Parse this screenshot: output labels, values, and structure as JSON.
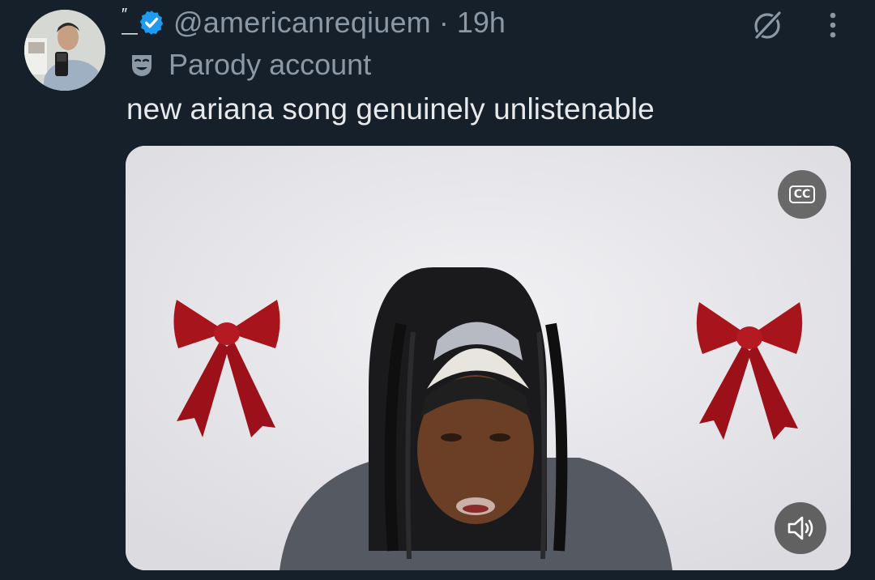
{
  "tweet": {
    "handle": "@americanreqiuem",
    "separator": "·",
    "time": "19h",
    "account_label": "Parody account",
    "text": "new ariana song genuinely unlistenable",
    "name_fragment": "″—"
  },
  "media": {
    "captions_label": "CC"
  },
  "icons": {
    "verified": "verified-badge-icon",
    "grok": "grok-icon",
    "more": "more-vertical-icon",
    "parody": "theater-mask-icon",
    "captions": "closed-captions-icon",
    "sound": "speaker-icon"
  },
  "colors": {
    "background": "#15202b",
    "verified_blue": "#1d9bf0",
    "secondary_text": "#8b98a5",
    "primary_text": "#e7e9ea",
    "bow_red": "#a8141c"
  }
}
